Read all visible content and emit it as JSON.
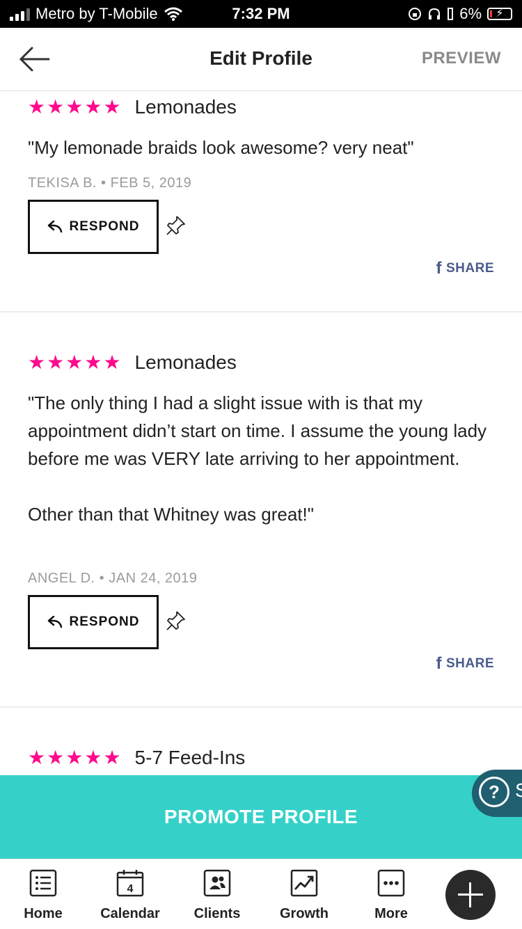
{
  "status_bar": {
    "carrier": "Metro by T-Mobile",
    "time": "7:32 PM",
    "battery_percent": "6%"
  },
  "header": {
    "title": "Edit Profile",
    "preview_label": "PREVIEW"
  },
  "reviews": [
    {
      "rating": 5,
      "service": "Lemonades",
      "text": "\"My lemonade braids look awesome? very neat\"",
      "meta": "TEKISA B. • FEB 5, 2019",
      "respond_label": "RESPOND",
      "share_label": "SHARE"
    },
    {
      "rating": 5,
      "service": "Lemonades",
      "text": "\"The only thing I had a slight issue with is that my appointment didn’t start on time. I assume the young lady before me was VERY late arriving to her appointment.\n\nOther than that Whitney was great!\"",
      "meta": "ANGEL D. • JAN 24, 2019",
      "respond_label": "RESPOND",
      "share_label": "SHARE"
    },
    {
      "rating": 5,
      "service": "5-7 Feed-Ins"
    }
  ],
  "promote": {
    "label": "PROMOTE PROFILE"
  },
  "help": {
    "icon": "?",
    "cut_text": "S"
  },
  "tabbar": {
    "tabs": [
      {
        "label": "Home",
        "icon": "list-icon"
      },
      {
        "label": "Calendar",
        "icon": "calendar-icon",
        "badge": "4"
      },
      {
        "label": "Clients",
        "icon": "clients-icon"
      },
      {
        "label": "Growth",
        "icon": "growth-icon"
      },
      {
        "label": "More",
        "icon": "more-icon"
      }
    ]
  },
  "colors": {
    "star": "#ff0a8c",
    "promote_bg": "#35d1c9",
    "help_bg": "#1f5f70",
    "share": "#4a5b8c"
  }
}
